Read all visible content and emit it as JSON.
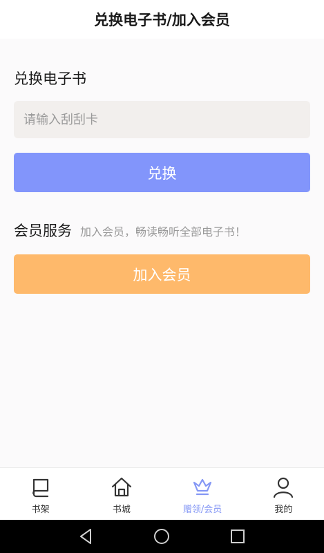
{
  "header": {
    "title": "兑换电子书/加入会员"
  },
  "redeem": {
    "title": "兑换电子书",
    "input_placeholder": "请输入刮刮卡",
    "button_label": "兑换"
  },
  "membership": {
    "title": "会员服务",
    "description": "加入会员，畅读畅听全部电子书！",
    "button_label": "加入会员"
  },
  "tabbar": {
    "items": [
      {
        "label": "书架",
        "icon": "bookshelf-icon",
        "active": false
      },
      {
        "label": "书城",
        "icon": "home-icon",
        "active": false
      },
      {
        "label": "赠领/会员",
        "icon": "crown-icon",
        "active": true
      },
      {
        "label": "我的",
        "icon": "user-icon",
        "active": false
      }
    ],
    "active_color": "#8497f5"
  },
  "system_nav": {
    "icons": [
      "back-icon",
      "home-circle-icon",
      "recents-icon"
    ]
  },
  "colors": {
    "redeem_button": "#8295fb",
    "join_button": "#feb96b",
    "input_background": "#f2efed"
  }
}
